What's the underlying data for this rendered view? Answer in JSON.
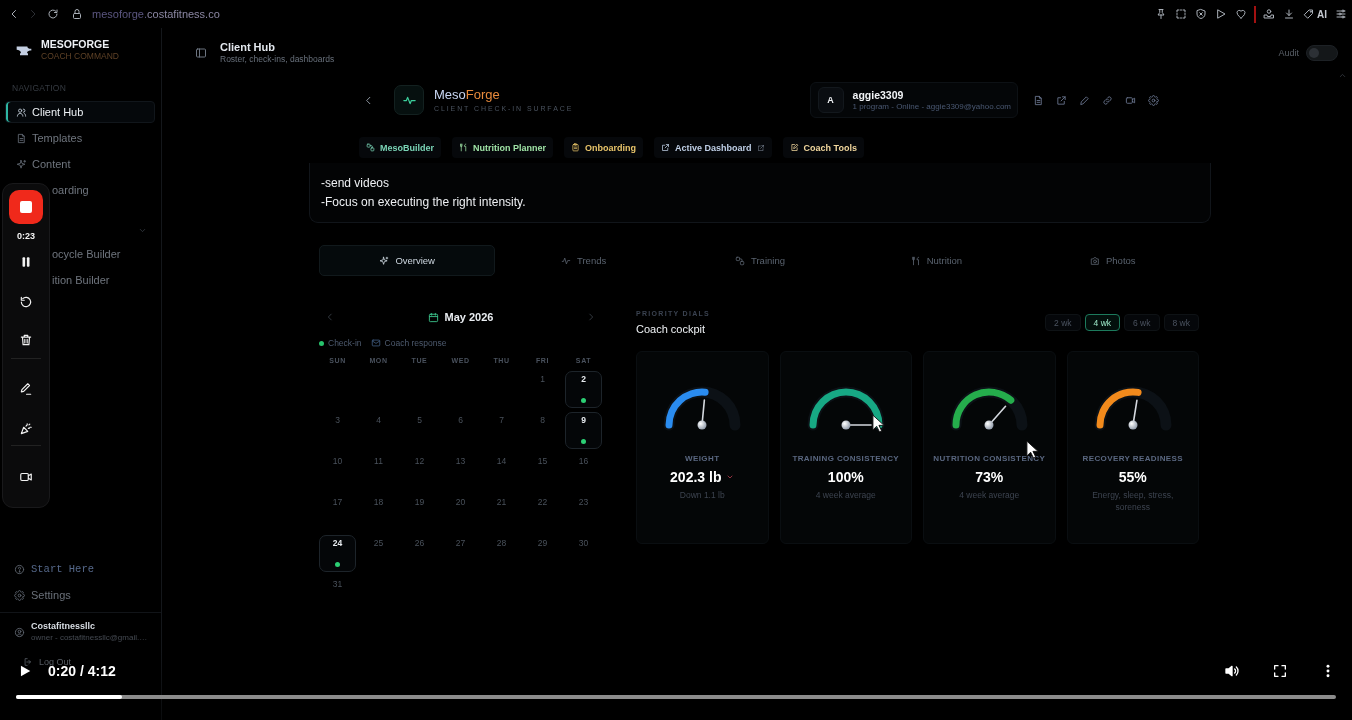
{
  "browser": {
    "url_subdomain": "mesoforge.",
    "url_domain": "costafitness.co",
    "forward_disabled": true,
    "ai_label": "AI"
  },
  "sidebar": {
    "brand": "MESOFORGE",
    "tagline": "COACH COMMAND",
    "section_label": "NAVIGATION",
    "items": [
      {
        "kind": "users",
        "label": "Client Hub",
        "selected": true
      },
      {
        "kind": "document",
        "label": "Templates",
        "selected": false
      },
      {
        "kind": "sparkle",
        "label": "Content",
        "selected": false
      },
      {
        "kind": "covered",
        "label": "oarding",
        "selected": false
      }
    ],
    "group": {
      "expanded": true,
      "children": [
        {
          "kind": "covered",
          "label": "ocycle Builder",
          "selected": false
        },
        {
          "kind": "covered",
          "label": "ition Builder",
          "selected": false
        }
      ]
    },
    "footer_items": [
      {
        "kind": "help",
        "label": "Start Here"
      },
      {
        "kind": "gear",
        "label": "Settings"
      }
    ],
    "user": {
      "name": "Costafitnessllc",
      "detail": "owner - costafitnessllc@gmail.…"
    },
    "logout": "Log Out"
  },
  "header": {
    "title": "Client Hub",
    "subtitle": "Roster, check-ins, dashboards",
    "audit_label": "Audit",
    "audit_on": false
  },
  "surface": {
    "brand_first": "Meso",
    "brand_second": "Forge",
    "subtitle": "CLIENT CHECK-IN SURFACE"
  },
  "client": {
    "initial": "A",
    "name": "aggie3309",
    "detail": "1 program - Online - aggie3309@yahoo.com"
  },
  "quick_links": [
    {
      "kind": "blocks",
      "label": "MesoBuilder",
      "color": "#7ad4b6"
    },
    {
      "kind": "utensils",
      "label": "Nutrition Planner",
      "color": "#9fe3a6"
    },
    {
      "kind": "clipboard",
      "label": "Onboarding",
      "color": "#e8c46a"
    },
    {
      "kind": "external",
      "label": "Active Dashboard",
      "color": "#bfcfe6"
    },
    {
      "kind": "edit",
      "label": "Coach Tools",
      "color": "#f0d69c"
    }
  ],
  "notes": [
    "-send videos",
    "-Focus on executing the right intensity."
  ],
  "tabs": [
    {
      "kind": "sparkle",
      "label": "Overview",
      "selected": true
    },
    {
      "kind": "activity",
      "label": "Trends",
      "selected": false
    },
    {
      "kind": "blocks",
      "label": "Training",
      "selected": false
    },
    {
      "kind": "utensils",
      "label": "Nutrition",
      "selected": false
    },
    {
      "kind": "camera",
      "label": "Photos",
      "selected": false
    }
  ],
  "calendar": {
    "month": "May 2026",
    "legend": [
      {
        "kind": "dot",
        "label": "Check-in"
      },
      {
        "kind": "mail",
        "label": "Coach response"
      }
    ],
    "weekdays": [
      "SUN",
      "MON",
      "TUE",
      "WED",
      "THU",
      "FRI",
      "SAT"
    ],
    "weeks": [
      [
        {
          "day": "1",
          "check_in": false
        },
        {
          "day": "2",
          "check_in": true
        }
      ],
      [
        {
          "day": "3",
          "check_in": false
        },
        {
          "day": "4",
          "check_in": false
        },
        {
          "day": "5",
          "check_in": false
        },
        {
          "day": "6",
          "check_in": false
        },
        {
          "day": "7",
          "check_in": false
        },
        {
          "day": "8",
          "check_in": false
        },
        {
          "day": "9",
          "check_in": true
        }
      ],
      [
        {
          "day": "10",
          "check_in": false
        },
        {
          "day": "11",
          "check_in": false
        },
        {
          "day": "12",
          "check_in": false
        },
        {
          "day": "13",
          "check_in": false
        },
        {
          "day": "14",
          "check_in": false
        },
        {
          "day": "15",
          "check_in": false
        },
        {
          "day": "16",
          "check_in": false
        }
      ],
      [
        {
          "day": "17",
          "check_in": false
        },
        {
          "day": "18",
          "check_in": false
        },
        {
          "day": "19",
          "check_in": false
        },
        {
          "day": "20",
          "check_in": false
        },
        {
          "day": "21",
          "check_in": false
        },
        {
          "day": "22",
          "check_in": false
        },
        {
          "day": "23",
          "check_in": false
        }
      ],
      [
        {
          "day": "24",
          "check_in": true
        },
        {
          "day": "25",
          "check_in": false
        },
        {
          "day": "26",
          "check_in": false
        },
        {
          "day": "27",
          "check_in": false
        },
        {
          "day": "28",
          "check_in": false
        },
        {
          "day": "29",
          "check_in": false
        },
        {
          "day": "30",
          "check_in": false
        }
      ],
      [
        {
          "day": "31",
          "check_in": false
        }
      ]
    ]
  },
  "dials": {
    "eyebrow": "PRIORITY DIALS",
    "title": "Coach cockpit",
    "ranges": [
      {
        "label": "2 wk",
        "selected": false
      },
      {
        "label": "4 wk",
        "selected": true
      },
      {
        "label": "6 wk",
        "selected": false
      },
      {
        "label": "8 wk",
        "selected": false
      }
    ],
    "cards": [
      {
        "label": "WEIGHT",
        "value": "202.3 lb",
        "down": true,
        "note": "Down 1.1 lb",
        "level": 0.53,
        "color": "#2a8cf0"
      },
      {
        "label": "TRAINING CONSISTENCY",
        "value": "100%",
        "note": "4 week average",
        "level": 1,
        "color": "#17a884"
      },
      {
        "label": "NUTRITION CONSISTENCY",
        "value": "73%",
        "note": "4 week average",
        "level": 0.73,
        "color": "#25ad4c"
      },
      {
        "label": "RECOVERY READINESS",
        "value": "55%",
        "note": "Energy, sleep, stress, soreness",
        "level": 0.55,
        "color": "#f28a1c"
      }
    ]
  },
  "recorder": {
    "elapsed": "0:23"
  },
  "player": {
    "time": "0:20 / 4:12",
    "progress": {
      "level": 0.08
    }
  }
}
